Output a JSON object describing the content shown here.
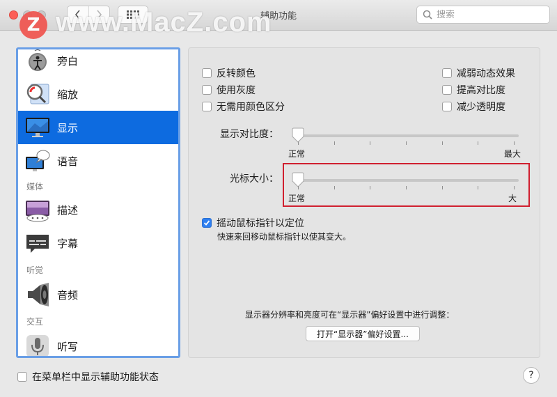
{
  "window": {
    "title": "辅助功能",
    "search_placeholder": "搜索",
    "watermark_logo": "Z",
    "watermark_text": "www.MacZ.com"
  },
  "sidebar": {
    "items": [
      {
        "label": "旁白",
        "icon": "voiceover-icon"
      },
      {
        "label": "缩放",
        "icon": "zoom-icon"
      },
      {
        "label": "显示",
        "icon": "display-icon",
        "selected": true
      },
      {
        "label": "语音",
        "icon": "speech-icon"
      },
      {
        "label": "描述",
        "icon": "descriptions-icon"
      },
      {
        "label": "字幕",
        "icon": "captions-icon"
      },
      {
        "label": "音频",
        "icon": "audio-icon"
      },
      {
        "label": "听写",
        "icon": "dictation-icon"
      }
    ],
    "sections": {
      "media": "媒体",
      "hearing": "听觉",
      "interaction": "交互"
    }
  },
  "main": {
    "checkboxes_left": [
      {
        "label": "反转颜色",
        "checked": false
      },
      {
        "label": "使用灰度",
        "checked": false
      },
      {
        "label": "无需用颜色区分",
        "checked": false
      }
    ],
    "checkboxes_right": [
      {
        "label": "减弱动态效果",
        "checked": false
      },
      {
        "label": "提高对比度",
        "checked": false
      },
      {
        "label": "减少透明度",
        "checked": false
      }
    ],
    "contrast_slider": {
      "label": "显示对比度：",
      "min_label": "正常",
      "max_label": "最大",
      "value": 0
    },
    "cursor_slider": {
      "label": "光标大小：",
      "min_label": "正常",
      "max_label": "大",
      "value": 0
    },
    "shake_checkbox": {
      "label": "摇动鼠标指针以定位",
      "checked": true,
      "description": "快速来回移动鼠标指针以使其变大。"
    },
    "display_note": "显示器分辨率和亮度可在“显示器”偏好设置中进行调整：",
    "open_display_button": "打开“显示器”偏好设置..."
  },
  "footer": {
    "menubar_checkbox": {
      "label": "在菜单栏中显示辅助功能状态",
      "checked": false
    },
    "help_label": "?"
  },
  "colors": {
    "selected": "#0d6be0",
    "sidebar_border": "#6a9fe6",
    "highlight_box": "#d01f2f",
    "checkbox_checked": "#2f7ff0"
  }
}
